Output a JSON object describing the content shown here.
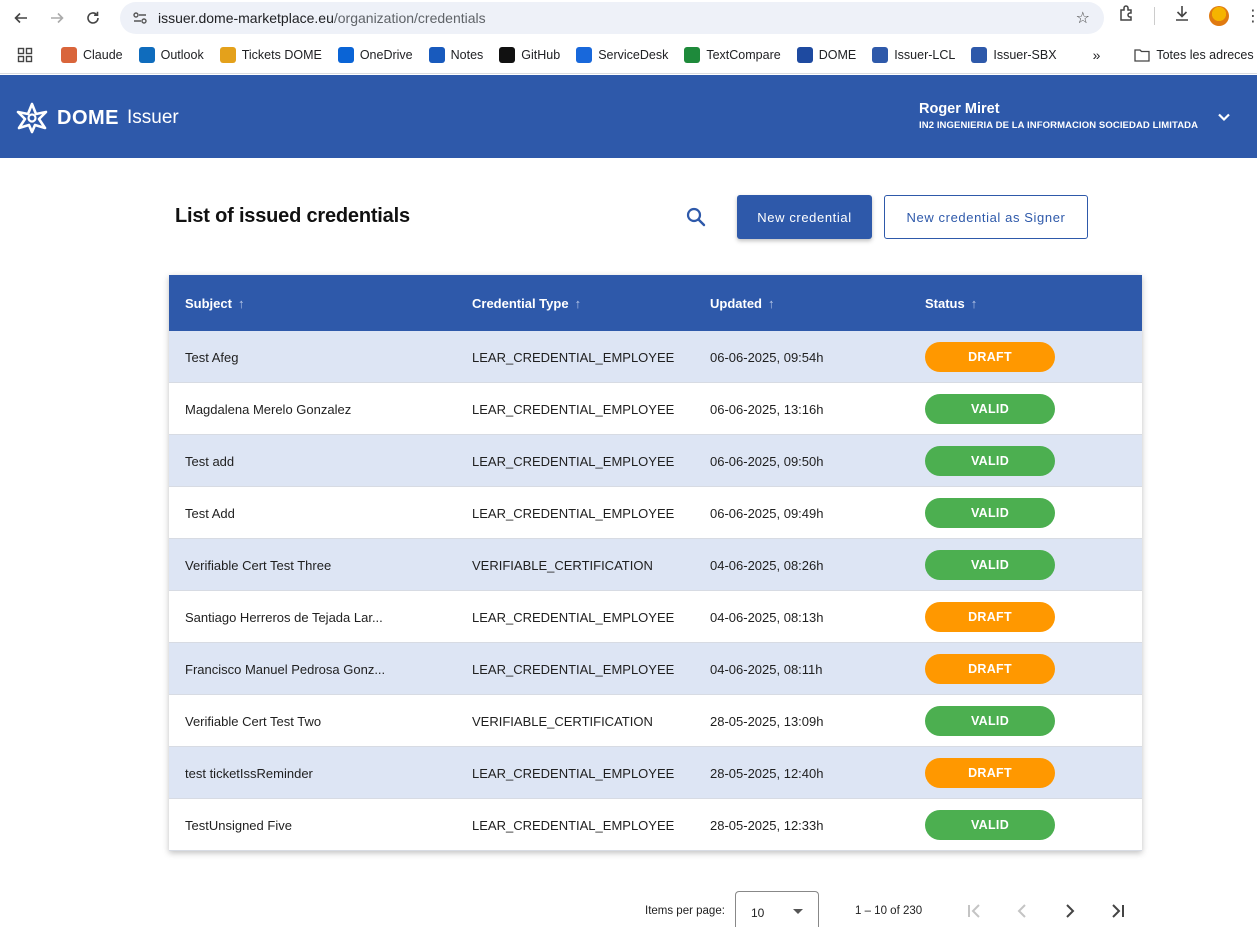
{
  "browser": {
    "url_host": "issuer.dome-marketplace.eu",
    "url_path": "/organization/credentials",
    "bookmarks": [
      {
        "label": "Claude",
        "icon": "claude-icon",
        "color": "#d9653b"
      },
      {
        "label": "Outlook",
        "icon": "outlook-icon",
        "color": "#0f6cbd"
      },
      {
        "label": "Tickets DOME",
        "icon": "tickets-icon",
        "color": "#e4a11b"
      },
      {
        "label": "OneDrive",
        "icon": "onedrive-icon",
        "color": "#0a64d6"
      },
      {
        "label": "Notes",
        "icon": "word-icon",
        "color": "#185abd"
      },
      {
        "label": "GitHub",
        "icon": "github-icon",
        "color": "#111111"
      },
      {
        "label": "ServiceDesk",
        "icon": "servicedesk-icon",
        "color": "#1868db"
      },
      {
        "label": "TextCompare",
        "icon": "textcompare-icon",
        "color": "#1e8a3b"
      },
      {
        "label": "DOME",
        "icon": "dome-icon",
        "color": "#1e4aa0"
      },
      {
        "label": "Issuer-LCL",
        "icon": "issuer-lcl-icon",
        "color": "#2e59aa"
      },
      {
        "label": "Issuer-SBX",
        "icon": "issuer-sbx-icon",
        "color": "#2e59aa"
      }
    ],
    "more_bookmarks": "»",
    "all_bookmarks_label": "Totes les adreces d'interès"
  },
  "header": {
    "logo_dome": "DOME",
    "logo_issuer": "Issuer",
    "user_name": "Roger Miret",
    "user_org": "IN2 INGENIERIA DE LA INFORMACION SOCIEDAD LIMITADA"
  },
  "toolbar": {
    "title": "List of issued credentials",
    "new_credential": "New credential",
    "new_credential_signer": "New credential as Signer"
  },
  "table": {
    "columns": [
      "Subject",
      "Credential Type",
      "Updated",
      "Status"
    ],
    "sort_arrow": "↑",
    "rows": [
      {
        "subject": "Test Afeg",
        "type": "LEAR_CREDENTIAL_EMPLOYEE",
        "updated": "06-06-2025, 09:54h",
        "status": "DRAFT"
      },
      {
        "subject": "Magdalena Merelo Gonzalez",
        "type": "LEAR_CREDENTIAL_EMPLOYEE",
        "updated": "06-06-2025, 13:16h",
        "status": "VALID"
      },
      {
        "subject": "Test add",
        "type": "LEAR_CREDENTIAL_EMPLOYEE",
        "updated": "06-06-2025, 09:50h",
        "status": "VALID"
      },
      {
        "subject": "Test Add",
        "type": "LEAR_CREDENTIAL_EMPLOYEE",
        "updated": "06-06-2025, 09:49h",
        "status": "VALID"
      },
      {
        "subject": "Verifiable Cert Test Three",
        "type": "VERIFIABLE_CERTIFICATION",
        "updated": "04-06-2025, 08:26h",
        "status": "VALID"
      },
      {
        "subject": "Santiago Herreros de Tejada Lar...",
        "type": "LEAR_CREDENTIAL_EMPLOYEE",
        "updated": "04-06-2025, 08:13h",
        "status": "DRAFT"
      },
      {
        "subject": "Francisco Manuel Pedrosa Gonz...",
        "type": "LEAR_CREDENTIAL_EMPLOYEE",
        "updated": "04-06-2025, 08:11h",
        "status": "DRAFT"
      },
      {
        "subject": "Verifiable Cert Test Two",
        "type": "VERIFIABLE_CERTIFICATION",
        "updated": "28-05-2025, 13:09h",
        "status": "VALID"
      },
      {
        "subject": "test ticketIssReminder",
        "type": "LEAR_CREDENTIAL_EMPLOYEE",
        "updated": "28-05-2025, 12:40h",
        "status": "DRAFT"
      },
      {
        "subject": "TestUnsigned Five",
        "type": "LEAR_CREDENTIAL_EMPLOYEE",
        "updated": "28-05-2025, 12:33h",
        "status": "VALID"
      }
    ]
  },
  "status_colors": {
    "DRAFT": "#ff9800",
    "VALID": "#4caf50"
  },
  "colors": {
    "primary": "#2e59aa",
    "row_alt": "#dde5f4"
  },
  "paginator": {
    "items_per_page_label": "Items per page:",
    "items_per_page": "10",
    "range": "1 – 10 of 230"
  }
}
